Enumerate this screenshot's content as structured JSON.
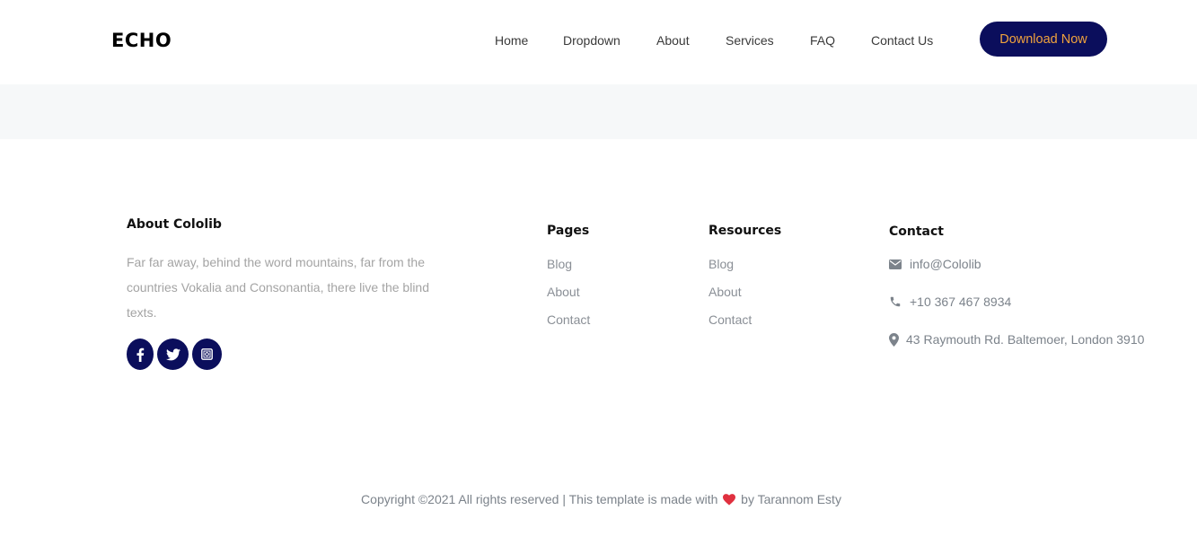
{
  "brand": {
    "logo": "ECHO"
  },
  "nav": {
    "items": [
      "Home",
      "Dropdown",
      "About",
      "Services",
      "FAQ",
      "Contact Us"
    ],
    "cta": "Download Now"
  },
  "footer": {
    "about": {
      "title": "About Cololib",
      "text": "Far far away, behind the word mountains, far from the countries Vokalia and Consonantia, there live the blind texts.",
      "social": [
        "facebook-icon",
        "twitter-icon",
        "instagram-icon"
      ]
    },
    "pages": {
      "title": "Pages",
      "links": [
        "Blog",
        "About",
        "Contact"
      ]
    },
    "resources": {
      "title": "Resources",
      "links": [
        "Blog",
        "About",
        "Contact"
      ]
    },
    "contact": {
      "title": "Contact",
      "email": "info@Cololib",
      "phone": "+10 367 467 8934",
      "address": "43 Raymouth Rd. Baltemoer, London 3910"
    },
    "copyright": {
      "prefix": "Copyright ©2021 All rights reserved | This template is made with",
      "suffix": "by Tarannom Esty"
    }
  },
  "colors": {
    "brand_navy": "#0b0e5c",
    "cta_text": "#f1a33c",
    "heart": "#e0303f",
    "band": "#f6f8f9",
    "muted_text": "#8a8f96"
  }
}
